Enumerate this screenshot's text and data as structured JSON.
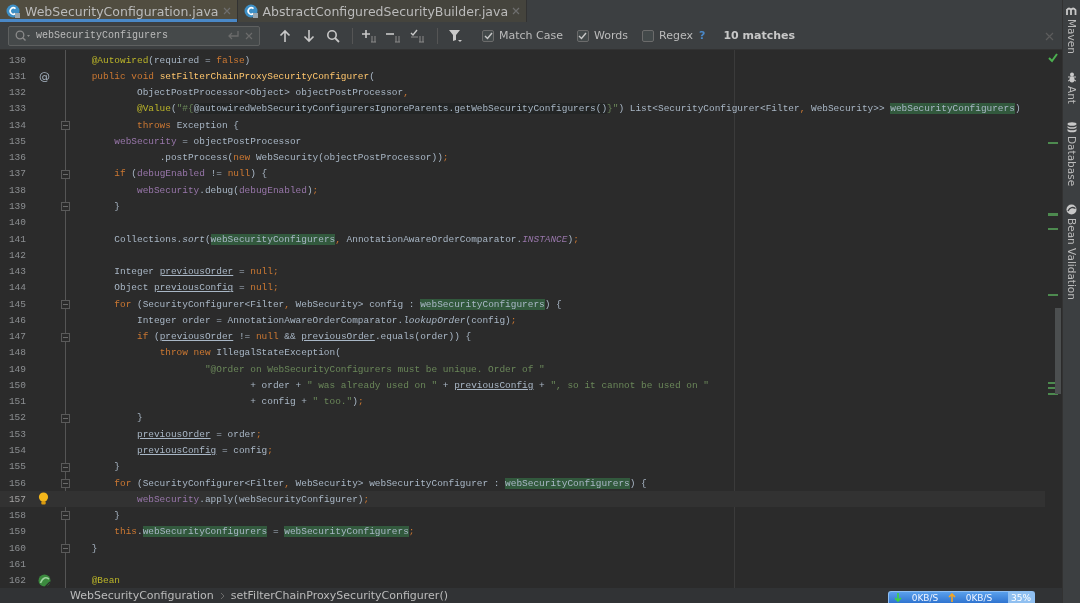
{
  "tabs": [
    {
      "label": "WebSecurityConfiguration.java",
      "selected": true
    },
    {
      "label": "AbstractConfiguredSecurityBuilder.java",
      "selected": false
    }
  ],
  "find_bar": {
    "query": "webSecurityConfigurers",
    "options": [
      {
        "label": "Match Case",
        "checked": true
      },
      {
        "label": "Words",
        "checked": true
      },
      {
        "label": "Regex",
        "checked": false
      }
    ],
    "help": "?",
    "match_count": "10 matches"
  },
  "editor": {
    "lines": [
      {
        "number": "130",
        "fold": false,
        "current": false,
        "tokens": [
          {
            "kind": "ann",
            "text": "    @Autowired"
          },
          {
            "kind": "plain",
            "text": "(required = "
          },
          {
            "kind": "kw",
            "text": "false"
          },
          {
            "kind": "plain",
            "text": ")"
          }
        ]
      },
      {
        "number": "131",
        "fold": false,
        "current": false,
        "gutter_text": "@",
        "tokens": [
          {
            "kind": "kw",
            "text": "    public void "
          },
          {
            "kind": "method",
            "text": "setFilterChainProxySecurityConfigurer"
          },
          {
            "kind": "plain",
            "text": "("
          }
        ]
      },
      {
        "number": "132",
        "fold": false,
        "current": false,
        "tokens": [
          {
            "kind": "plain",
            "text": "            ObjectPostProcessor<Object> objectPostProcessor"
          },
          {
            "kind": "kw",
            "text": ","
          }
        ]
      },
      {
        "number": "133",
        "fold": false,
        "current": false,
        "tokens": [
          {
            "kind": "ann",
            "text": "            @Value"
          },
          {
            "kind": "plain",
            "text": "("
          },
          {
            "kind": "str",
            "text": "\"#{"
          },
          {
            "kind": "inject",
            "text": "@autowiredWebSecurityConfigurersIgnoreParents.getWebSecurityConfigurers()"
          },
          {
            "kind": "str",
            "text": "}\""
          },
          {
            "kind": "plain",
            "text": ") List<SecurityConfigurer<Filter"
          },
          {
            "kind": "kw",
            "text": ","
          },
          {
            "kind": "plain",
            "text": " WebSecurity>> "
          },
          {
            "kind": "match",
            "text": "webSecurityConfigurers"
          },
          {
            "kind": "plain",
            "text": ")"
          }
        ]
      },
      {
        "number": "134",
        "fold": true,
        "current": false,
        "tokens": [
          {
            "kind": "kw",
            "text": "            throws "
          },
          {
            "kind": "plain",
            "text": "Exception {"
          }
        ]
      },
      {
        "number": "135",
        "fold": false,
        "current": false,
        "tokens": [
          {
            "kind": "field",
            "text": "        webSecurity"
          },
          {
            "kind": "plain",
            "text": " = objectPostProcessor"
          }
        ]
      },
      {
        "number": "136",
        "fold": false,
        "current": false,
        "tokens": [
          {
            "kind": "plain",
            "text": "                .postProcess("
          },
          {
            "kind": "kw",
            "text": "new "
          },
          {
            "kind": "plain",
            "text": "WebSecurity(objectPostProcessor))"
          },
          {
            "kind": "kw",
            "text": ";"
          }
        ]
      },
      {
        "number": "137",
        "fold": true,
        "current": false,
        "tokens": [
          {
            "kind": "kw",
            "text": "        if "
          },
          {
            "kind": "plain",
            "text": "("
          },
          {
            "kind": "field",
            "text": "debugEnabled"
          },
          {
            "kind": "plain",
            "text": " != "
          },
          {
            "kind": "kw",
            "text": "null"
          },
          {
            "kind": "plain",
            "text": ") {"
          }
        ]
      },
      {
        "number": "138",
        "fold": false,
        "current": false,
        "tokens": [
          {
            "kind": "field",
            "text": "            webSecurity"
          },
          {
            "kind": "plain",
            "text": ".debug("
          },
          {
            "kind": "field",
            "text": "debugEnabled"
          },
          {
            "kind": "plain",
            "text": ")"
          },
          {
            "kind": "kw",
            "text": ";"
          }
        ]
      },
      {
        "number": "139",
        "fold": true,
        "current": false,
        "tokens": [
          {
            "kind": "plain",
            "text": "        }"
          }
        ]
      },
      {
        "number": "140",
        "fold": false,
        "current": false
      },
      {
        "number": "141",
        "fold": false,
        "current": false,
        "tokens": [
          {
            "kind": "plain",
            "text": "        Collections."
          },
          {
            "kind": "italic",
            "text": "sort"
          },
          {
            "kind": "plain",
            "text": "("
          },
          {
            "kind": "match",
            "text": "webSecurityConfigurers"
          },
          {
            "kind": "kw",
            "text": ","
          },
          {
            "kind": "plain",
            "text": " AnnotationAwareOrderComparator."
          },
          {
            "kind": "const",
            "text": "INSTANCE"
          },
          {
            "kind": "plain",
            "text": ")"
          },
          {
            "kind": "kw",
            "text": ";"
          }
        ]
      },
      {
        "number": "142",
        "fold": false,
        "current": false
      },
      {
        "number": "143",
        "fold": false,
        "current": false,
        "tokens": [
          {
            "kind": "plain",
            "text": "        Integer "
          },
          {
            "kind": "reassigned",
            "text": "previousOrder"
          },
          {
            "kind": "plain",
            "text": " = "
          },
          {
            "kind": "kw",
            "text": "null;"
          }
        ]
      },
      {
        "number": "144",
        "fold": false,
        "current": false,
        "tokens": [
          {
            "kind": "plain",
            "text": "        Object "
          },
          {
            "kind": "reassigned",
            "text": "previousConfig"
          },
          {
            "kind": "plain",
            "text": " = "
          },
          {
            "kind": "kw",
            "text": "null;"
          }
        ]
      },
      {
        "number": "145",
        "fold": true,
        "current": false,
        "tokens": [
          {
            "kind": "kw",
            "text": "        for "
          },
          {
            "kind": "plain",
            "text": "(SecurityConfigurer<Filter"
          },
          {
            "kind": "kw",
            "text": ","
          },
          {
            "kind": "plain",
            "text": " WebSecurity> config : "
          },
          {
            "kind": "match",
            "text": "webSecurityConfigurers"
          },
          {
            "kind": "plain",
            "text": ") {"
          }
        ]
      },
      {
        "number": "146",
        "fold": false,
        "current": false,
        "tokens": [
          {
            "kind": "plain",
            "text": "            Integer order = AnnotationAwareOrderComparator."
          },
          {
            "kind": "italic",
            "text": "lookupOrder"
          },
          {
            "kind": "plain",
            "text": "(config)"
          },
          {
            "kind": "kw",
            "text": ";"
          }
        ]
      },
      {
        "number": "147",
        "fold": true,
        "current": false,
        "tokens": [
          {
            "kind": "kw",
            "text": "            if "
          },
          {
            "kind": "plain",
            "text": "("
          },
          {
            "kind": "reassigned",
            "text": "previousOrder"
          },
          {
            "kind": "plain",
            "text": " != "
          },
          {
            "kind": "kw",
            "text": "null"
          },
          {
            "kind": "plain",
            "text": " && "
          },
          {
            "kind": "reassigned",
            "text": "previousOrder"
          },
          {
            "kind": "plain",
            "text": ".equals(order)) {"
          }
        ]
      },
      {
        "number": "148",
        "fold": false,
        "current": false,
        "tokens": [
          {
            "kind": "kw",
            "text": "                throw new "
          },
          {
            "kind": "plain",
            "text": "IllegalStateException("
          }
        ]
      },
      {
        "number": "149",
        "fold": false,
        "current": false,
        "tokens": [
          {
            "kind": "str",
            "text": "                        \"@Order on WebSecurityConfigurers must be unique. Order of \""
          }
        ]
      },
      {
        "number": "150",
        "fold": false,
        "current": false,
        "tokens": [
          {
            "kind": "plain",
            "text": "                                + order + "
          },
          {
            "kind": "str",
            "text": "\" was already used on \""
          },
          {
            "kind": "plain",
            "text": " + "
          },
          {
            "kind": "reassigned",
            "text": "previousConfig"
          },
          {
            "kind": "plain",
            "text": " + "
          },
          {
            "kind": "str",
            "text": "\", so it cannot be used on \""
          }
        ]
      },
      {
        "number": "151",
        "fold": false,
        "current": false,
        "tokens": [
          {
            "kind": "plain",
            "text": "                                + config + "
          },
          {
            "kind": "str",
            "text": "\" too.\""
          },
          {
            "kind": "plain",
            "text": ")"
          },
          {
            "kind": "kw",
            "text": ";"
          }
        ]
      },
      {
        "number": "152",
        "fold": true,
        "current": false,
        "tokens": [
          {
            "kind": "plain",
            "text": "            }"
          }
        ]
      },
      {
        "number": "153",
        "fold": false,
        "current": false,
        "tokens": [
          {
            "kind": "reassigned",
            "text": "            previousOrder"
          },
          {
            "kind": "plain",
            "text": " = order"
          },
          {
            "kind": "kw",
            "text": ";"
          }
        ]
      },
      {
        "number": "154",
        "fold": false,
        "current": false,
        "tokens": [
          {
            "kind": "reassigned",
            "text": "            previousConfig"
          },
          {
            "kind": "plain",
            "text": " = config"
          },
          {
            "kind": "kw",
            "text": ";"
          }
        ]
      },
      {
        "number": "155",
        "fold": true,
        "current": false,
        "tokens": [
          {
            "kind": "plain",
            "text": "        }"
          }
        ]
      },
      {
        "number": "156",
        "fold": true,
        "current": false,
        "tokens": [
          {
            "kind": "kw",
            "text": "        for "
          },
          {
            "kind": "plain",
            "text": "(SecurityConfigurer<Filter"
          },
          {
            "kind": "kw",
            "text": ","
          },
          {
            "kind": "plain",
            "text": " WebSecurity> webSecurityConfigurer : "
          },
          {
            "kind": "match",
            "text": "webSecurityConfigurers"
          },
          {
            "kind": "plain",
            "text": ") {"
          }
        ]
      },
      {
        "number": "157",
        "fold": false,
        "current": true,
        "gutter": {
          "kind": "bulb"
        },
        "tokens": [
          {
            "kind": "field",
            "text": "            webSecurity"
          },
          {
            "kind": "plain",
            "text": ".apply(webSecurityConfigurer)"
          },
          {
            "kind": "kw",
            "text": ";"
          }
        ]
      },
      {
        "number": "158",
        "fold": true,
        "current": false,
        "tokens": [
          {
            "kind": "plain",
            "text": "        }"
          }
        ]
      },
      {
        "number": "159",
        "fold": false,
        "current": false,
        "tokens": [
          {
            "kind": "kw",
            "text": "        this"
          },
          {
            "kind": "plain",
            "text": "."
          },
          {
            "kind": "match",
            "text": "webSecurityConfigurers"
          },
          {
            "kind": "plain",
            "text": " = "
          },
          {
            "kind": "match",
            "text": "webSecurityConfigurers"
          },
          {
            "kind": "kw",
            "text": ";"
          }
        ]
      },
      {
        "number": "160",
        "fold": true,
        "current": false,
        "tokens": [
          {
            "kind": "plain",
            "text": "    }"
          }
        ]
      },
      {
        "number": "161",
        "fold": false,
        "current": false
      },
      {
        "number": "162",
        "fold": false,
        "current": false,
        "gutter": {
          "kind": "bean"
        },
        "tokens": [
          {
            "kind": "ann",
            "text": "    @Bean"
          }
        ]
      }
    ]
  },
  "breadcrumbs": [
    "WebSecurityConfiguration",
    "setFilterChainProxySecurityConfigurer()"
  ],
  "tool_strip": [
    {
      "label": "Maven",
      "kind": "maven"
    },
    {
      "label": "Ant",
      "kind": "ant"
    },
    {
      "label": "Database",
      "kind": "database"
    },
    {
      "label": "Bean Validation",
      "kind": "bean"
    }
  ],
  "net_widget": {
    "down": "0KB/S",
    "up": "0KB/S",
    "percent": "35%"
  }
}
